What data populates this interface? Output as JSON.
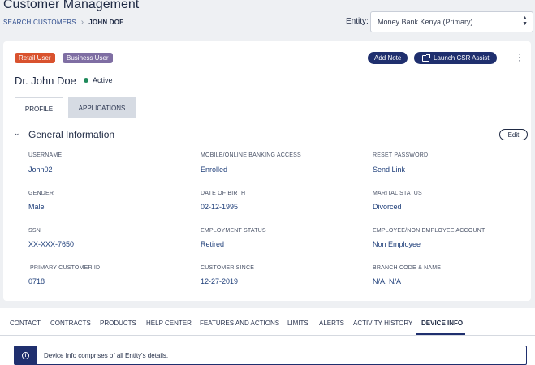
{
  "header": {
    "title": "Customer Management",
    "breadcrumb": {
      "link": "SEARCH CUSTOMERS",
      "current": "JOHN DOE"
    },
    "entity_label": "Entity:",
    "entity_value": "Money Bank Kenya (Primary)"
  },
  "customer": {
    "badges": {
      "retail": "Retail User",
      "business": "Business User"
    },
    "name": "Dr. John Doe",
    "status": "Active",
    "actions": {
      "add_note": "Add Note",
      "launch_csr": "Launch  CSR Assist"
    }
  },
  "tabs": {
    "profile": "PROFILE",
    "applications": "APPLICATIONS"
  },
  "general": {
    "title": "General Information",
    "edit": "Edit",
    "fields": {
      "username": {
        "label": "USERNAME",
        "value": "John02"
      },
      "banking_access": {
        "label": "MOBILE/ONLINE BANKING ACCESS",
        "value": "Enrolled"
      },
      "reset_password": {
        "label": "RESET PASSWORD",
        "value": "Send Link"
      },
      "gender": {
        "label": "GENDER",
        "value": "Male"
      },
      "dob": {
        "label": "DATE OF BIRTH",
        "value": "02-12-1995"
      },
      "marital": {
        "label": "MARITAL STATUS",
        "value": "Divorced"
      },
      "ssn": {
        "label": "SSN",
        "value": "XX-XXX-7650"
      },
      "employment": {
        "label": "EMPLOYMENT STATUS",
        "value": "Retired"
      },
      "employee_account": {
        "label": "EMPLOYEE/NON EMPLOYEE ACCOUNT",
        "value": "Non Employee"
      },
      "primary_id": {
        "label": "PRIMARY CUSTOMER ID",
        "value": "0718"
      },
      "since": {
        "label": "CUSTOMER SINCE",
        "value": "12-27-2019"
      },
      "branch": {
        "label": "BRANCH CODE & NAME",
        "value": "N/A, N/A"
      }
    }
  },
  "bottom_tabs": [
    "CONTACT",
    "CONTRACTS",
    "PRODUCTS",
    "HELP CENTER",
    "FEATURES AND ACTIONS",
    "LIMITS",
    "ALERTS",
    "ACTIVITY HISTORY",
    "DEVICE INFO"
  ],
  "info_message": "Device Info comprises of all Entity's details.",
  "colors": {
    "primary": "#1f2f6e",
    "retail_badge": "#d9522e",
    "business_badge": "#7f6ea3",
    "active_dot": "#1f8a5b"
  }
}
